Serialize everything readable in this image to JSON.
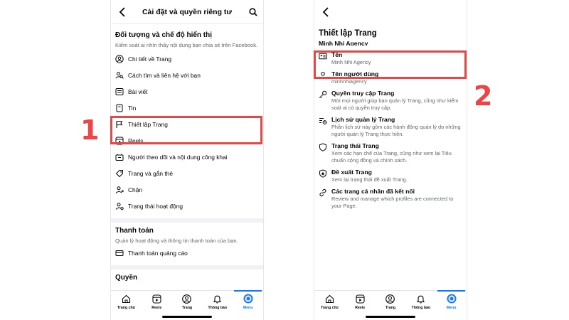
{
  "left": {
    "header_title": "Cài đặt và quyền riêng tư",
    "section1": {
      "title": "Đối tượng và chế độ hiển thị",
      "desc": "Kiểm soát ai nhìn thấy nội dung bạn chia sẻ trên Facebook."
    },
    "items": [
      {
        "label": "Chi tiết về Trang",
        "icon": "person-circle-icon"
      },
      {
        "label": "Cách tìm và liên hệ với bạn",
        "icon": "person-search-icon"
      },
      {
        "label": "Bài viết",
        "icon": "posts-icon"
      },
      {
        "label": "Tin",
        "icon": "stories-icon"
      },
      {
        "label": "Thiết lập Trang",
        "icon": "flag-icon"
      },
      {
        "label": "Reels",
        "icon": "reels-icon"
      },
      {
        "label": "Người theo dõi và nội dung công khai",
        "icon": "public-content-icon"
      },
      {
        "label": "Trang và gắn thẻ",
        "icon": "tag-icon"
      },
      {
        "label": "Chặn",
        "icon": "block-icon"
      },
      {
        "label": "Trạng thái hoạt động",
        "icon": "activity-status-icon"
      }
    ],
    "section2": {
      "title": "Thanh toán",
      "desc": "Quản lý hoạt động và thông tin thanh toán của bạn."
    },
    "payment_item": {
      "label": "Thanh toán quảng cáo",
      "icon": "ad-payments-icon"
    },
    "section3_title": "Quyền",
    "highlight_number": "1"
  },
  "right": {
    "page_title": "Thiết lập Trang",
    "page_name": "Minh Nhi Agency",
    "items": [
      {
        "title": "Tên",
        "desc": "Minh Nhi  Agency",
        "icon": "name-card-icon"
      },
      {
        "title": "Tên người dùng",
        "desc": "minhnhiagency",
        "icon": "username-icon"
      },
      {
        "title": "Quyền truy cập Trang",
        "desc": "Mời mọi người giúp bạn quản lý Trang, cũng như kiểm soát ai có quyền truy cập.",
        "icon": "key-icon"
      },
      {
        "title": "Lịch sử quản lý Trang",
        "desc": "Phần lịch sử này gồm các hành động quản lý do những người quản lý Trang thực hiện.",
        "icon": "history-list-icon"
      },
      {
        "title": "Trạng thái Trang",
        "desc": "Xem các hạn chế của Trang, cũng như xem lại Tiêu chuẩn cộng đồng và chính sách.",
        "icon": "shield-icon"
      },
      {
        "title": "Đề xuất Trang",
        "desc": "Xem lại trạng thái đề xuất Trang.",
        "icon": "recommend-icon"
      },
      {
        "title": "Các trang cá nhân đã kết nối",
        "desc": "Review and manage which profiles are connected to your Page.",
        "icon": "link-icon"
      }
    ],
    "highlight_number": "2"
  },
  "nav": [
    {
      "label": "Trang chủ",
      "icon": "home-icon"
    },
    {
      "label": "Reels",
      "icon": "reels-nav-icon"
    },
    {
      "label": "Trang",
      "icon": "profile-icon"
    },
    {
      "label": "Thông báo",
      "icon": "bell-icon"
    },
    {
      "label": "Menu",
      "icon": "menu-avatar-icon"
    }
  ],
  "colors": {
    "highlight": "#ea4646",
    "accent": "#1877f2"
  }
}
